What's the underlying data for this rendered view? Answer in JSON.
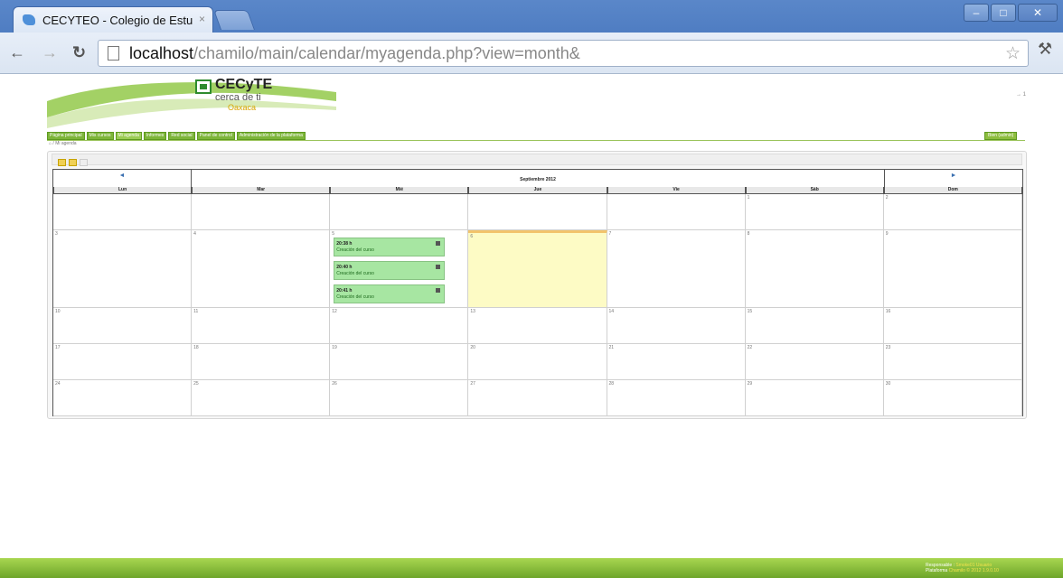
{
  "browser": {
    "tab_title": "CECYTEO - Colegio de Estu",
    "tab_close": "×",
    "url_host": "localhost",
    "url_path": "/chamilo/main/calendar/myagenda.php?view=month&"
  },
  "header": {
    "logo_title": "CECyTE",
    "logo_sub": "cerca de ti",
    "logo_state": "Oaxaca",
    "logout": "→ 1"
  },
  "menu": {
    "items": [
      {
        "label": "Página principal"
      },
      {
        "label": "Mis cursos"
      },
      {
        "label": "Mi agenda"
      },
      {
        "label": "Informes"
      },
      {
        "label": "Red social"
      },
      {
        "label": "Panel de control"
      },
      {
        "label": "Administración de la plataforma"
      }
    ],
    "user": "Bien (admin)"
  },
  "breadcrumb": "⌂ / Mi agenda",
  "calendar": {
    "prev": "◄",
    "next": "►",
    "month": "Septiembre 2012",
    "days": [
      "Lun",
      "Mar",
      "Mié",
      "Jue",
      "Vie",
      "Sáb",
      "Dom"
    ],
    "weeks": [
      [
        "",
        "",
        "",
        "",
        "",
        "1",
        "2"
      ],
      [
        "3",
        "4",
        "5",
        "6",
        "7",
        "8",
        "9"
      ],
      [
        "10",
        "11",
        "12",
        "13",
        "14",
        "15",
        "16"
      ],
      [
        "17",
        "18",
        "19",
        "20",
        "21",
        "22",
        "23"
      ],
      [
        "24",
        "25",
        "26",
        "27",
        "28",
        "29",
        "30"
      ]
    ],
    "today": "6",
    "events": [
      {
        "time": "20:38 h",
        "title": "Creación del curso"
      },
      {
        "time": "20:40 h",
        "title": "Creación del curso"
      },
      {
        "time": "20:41 h",
        "title": "Creación del curso"
      }
    ]
  },
  "footer": {
    "line1_label": "Responsable :",
    "line1_value": "Smoke01 Usuario",
    "line2_label": "Plataforma",
    "line2_value": "Chamilo © 2012 1.9.0.10"
  },
  "colors": {
    "menu_green": "#7db53a",
    "event_green": "#a7e6a2",
    "today_yellow": "#fdfbc5"
  }
}
